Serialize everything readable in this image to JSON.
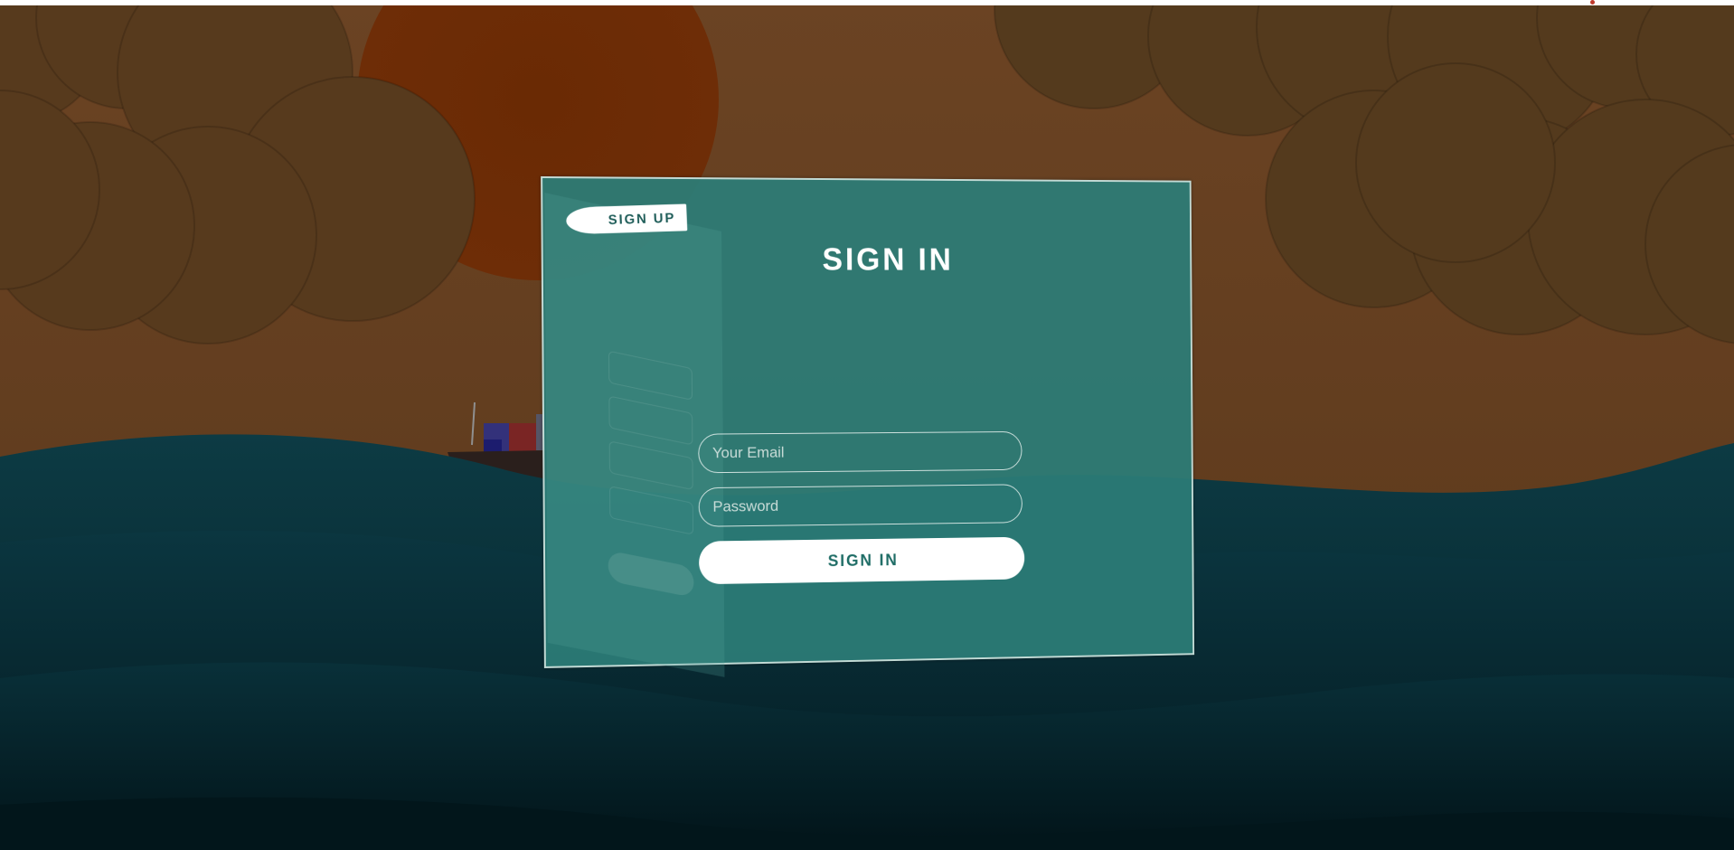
{
  "card": {
    "signup_tab_label": "SIGN UP",
    "title": "SIGN IN",
    "email_placeholder": "Your Email",
    "password_placeholder": "Password",
    "signin_button_label": "SIGN IN"
  },
  "colors": {
    "sky": "#5b3a1f",
    "sun": "#6e2a05",
    "cloud": "#5a3b1e",
    "sea_dark": "#062a33",
    "card": "#2b7c76",
    "accent_text": "#1f6d66"
  }
}
